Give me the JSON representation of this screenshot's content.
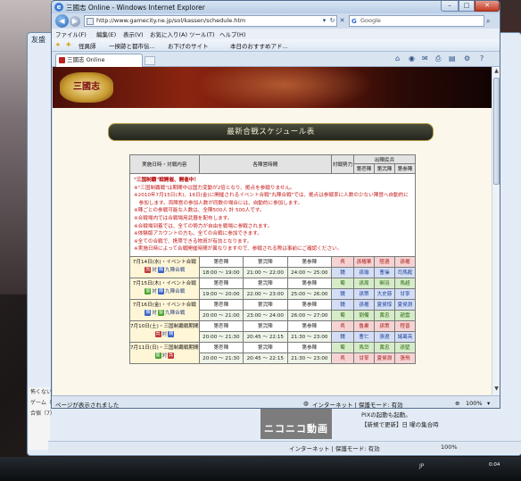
{
  "window": {
    "title": "三國志 Online - Windows Internet Explorer",
    "minimize": "–",
    "maximize": "□",
    "close": "✕"
  },
  "address": {
    "url": "http://www.gamecity.ne.jp/sol/kassen/schedule.htm",
    "search_placeholder": "Google",
    "search_engine_glyph": "G"
  },
  "menu": [
    "ファイル(F)",
    "編集(E)",
    "表示(V)",
    "お気に入り(A)",
    "ツール(T)",
    "ヘルプ(H)"
  ],
  "favorites": [
    "怪異師",
    "一揆跡と都市伝...",
    "お下げのサイト",
    "本日のおすすめアド..."
  ],
  "tab": {
    "label": "三國志 Online"
  },
  "page": {
    "logo": "三國志",
    "logo_sub": "Online",
    "heading": "最新合戦スケジュール表",
    "table_headers": {
      "datetime": "実施日時・対戦内容",
      "phases": "各陣営時間",
      "force": "対戦勢力",
      "camp": "出陣民兵",
      "camp1": "第壱陣",
      "camp2": "第弐陣",
      "camp3": "第参陣"
    },
    "notice": {
      "title": "\"三国制覇\"戦開催、開催中！",
      "lines": [
        "※\"三国制覇戦\"は期間中は国力変動が2倍となり、拠点を参戦りません。",
        "※2010年7月15日(木)、16日(金)に開催されるイベント合戦\"丸陣合戦\"では、拠点は参戦率に人数の少ない陣営へ自動的に",
        "　参加します。両陣営の参加人数が同数の場合には、自動的に参加します。",
        "※陣ごとの参戦可能な人数は、全陣500人 計 500人です。",
        "※合戦場内では合戦場用武器を配布します。",
        "※合戦場到着では、全ての勢力が自由を戦場に参戦されます。",
        "※体験版アカウントの方も、全ての合戦に参加できます。",
        "※全ての合戦で、携帯できる物資が有効となります。",
        "※実施日時によって合戦開催時間が異なりますので、参戦される際は事前にご確認ください。"
      ]
    },
    "events": [
      {
        "date": "7月14日(水)",
        "name": "イベント合戦",
        "a": "呉",
        "b": "魏",
        "match": "九陣合戦",
        "rows": [
          {
            "label": "第壱陣",
            "p1": "第弐陣",
            "p2": "第参陣",
            "force": "呉",
            "c1": "孫権軍",
            "c2": "陸遜",
            "c3": "孫権"
          },
          {
            "label": "18:00 〜 19:00",
            "p1": "21:00 〜 22:00",
            "p2": "24:00 〜 25:00",
            "force": "魏",
            "c1": "孫瑜",
            "c2": "曹操",
            "c3": "司馬懿"
          }
        ]
      },
      {
        "date": "7月15日(木)",
        "name": "イベント合戦",
        "a": "蜀",
        "b": "魏",
        "match": "九陣合戦",
        "rows": [
          {
            "label": "第壱陣",
            "p1": "第弐陣",
            "p2": "第参陣",
            "force": "蜀",
            "c1": "孫周",
            "c2": "関羽",
            "c3": "馬超"
          },
          {
            "label": "19:00 〜 20:00",
            "p1": "22:00 〜 23:00",
            "p2": "25:00 〜 26:00",
            "force": "魏",
            "c1": "孫策",
            "c2": "大史慈",
            "c3": "甘寧"
          }
        ]
      },
      {
        "date": "7月16日(金)",
        "name": "イベント合戦",
        "a": "魏",
        "b": "蜀",
        "match": "九陣合戦",
        "rows": [
          {
            "label": "第壱陣",
            "p1": "第弐陣",
            "p2": "第参陣",
            "force": "魏",
            "c1": "孫権",
            "c2": "夏侯惇",
            "c3": "夏侯淵"
          },
          {
            "label": "20:00 〜 21:00",
            "p1": "23:00 〜 24:00",
            "p2": "26:00 〜 27:00",
            "force": "蜀",
            "c1": "劉備",
            "c2": "黄忠",
            "c3": "趙雲"
          }
        ]
      },
      {
        "date": "7月10日(土)",
        "name": "三国制覇戦期間",
        "a": "呉",
        "b": "魏",
        "match": "",
        "rows": [
          {
            "label": "第壱陣",
            "p1": "第弐陣",
            "p2": "第参陣",
            "force": "呉",
            "c1": "魯粛",
            "c2": "孫策",
            "c3": "程普"
          },
          {
            "label": "20:00 〜 21:30",
            "p1": "20:45 〜 22:15",
            "p2": "21:30 〜 23:00",
            "force": "魏",
            "c1": "曹仁",
            "c2": "張遼",
            "c3": "諸葛亮"
          }
        ]
      },
      {
        "date": "7月11日(日)",
        "name": "三国制覇戦期間",
        "a": "蜀",
        "b": "呉",
        "match": "",
        "rows": [
          {
            "label": "第壱陣",
            "p1": "第弐陣",
            "p2": "第参陣",
            "force": "蜀",
            "c1": "馬岱",
            "c2": "黄忠",
            "c3": "孫堅"
          },
          {
            "label": "20:00 〜 21:30",
            "p1": "20:45 〜 22:15",
            "p2": "21:30 〜 23:00",
            "force": "呉",
            "c1": "甘寧",
            "c2": "夏侯淵",
            "c3": "張飛"
          }
        ]
      }
    ]
  },
  "status": {
    "left": "ページが表示されました",
    "zone": "インターネット | 保護モード: 有効",
    "zoom": "100%"
  },
  "back": {
    "title": "友盛",
    "left_items": [
      "怖くない話（22）",
      "ゲーム（65）",
      "合宿（7）"
    ],
    "nico": "ニコニコ動画",
    "notes": [
      "PIXの起動も起動。",
      "【新規で更新】日 曜の集合時"
    ],
    "status_zone": "インターネット | 保護モード: 有効",
    "status_zoom": "100%"
  },
  "taskbar": {
    "tray": "JP",
    "clock": "0:04"
  }
}
